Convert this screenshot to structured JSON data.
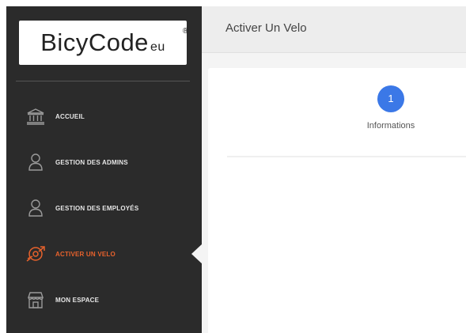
{
  "logo": {
    "brand": "BicyCode",
    "registered": "®",
    "suffix": "eu"
  },
  "sidebar": {
    "items": [
      {
        "label": "ACCUEIL",
        "icon": "bank-icon",
        "active": false
      },
      {
        "label": "GESTION DES ADMINS",
        "icon": "user-icon",
        "active": false
      },
      {
        "label": "GESTION DES EMPLOYÉS",
        "icon": "user-icon",
        "active": false
      },
      {
        "label": "ACTIVER UN VELO",
        "icon": "bike-tag-icon",
        "active": true
      },
      {
        "label": "MON ESPACE",
        "icon": "store-icon",
        "active": false
      }
    ]
  },
  "header": {
    "title": "Activer Un Velo"
  },
  "stepper": {
    "step_number": "1",
    "step_label": "Informations"
  },
  "colors": {
    "sidebar_bg": "#2b2b2b",
    "accent": "#e8622c",
    "step_blue": "#3b78e7"
  }
}
